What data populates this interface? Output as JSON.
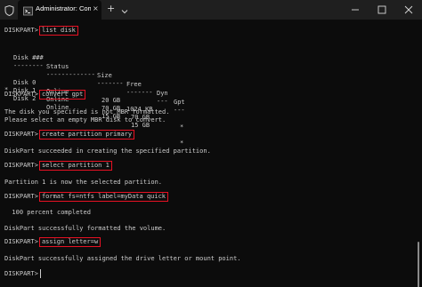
{
  "window": {
    "tab_title": "Administrator: Command Prompt",
    "new_tab_symbol": "+",
    "close_symbol": "×"
  },
  "console": {
    "prompt": "DISKPART>",
    "commands": {
      "list_disk": "list disk",
      "convert_gpt": "convert gpt",
      "create_partition": "create partition primary",
      "select_partition": "select partition 1",
      "format": "format fs=ntfs label=myData quick",
      "assign": "assign letter=w"
    },
    "disk_table": {
      "headers": [
        "Disk ###",
        "Status",
        "Size",
        "Free",
        "Dyn",
        "Gpt"
      ],
      "separators": [
        "--------",
        "-------------",
        "-------",
        "-------",
        "---",
        "---"
      ],
      "rows": [
        {
          "marker": "",
          "disk": "Disk 0",
          "status": "Online",
          "size": "20 GB",
          "free": "1024 KB",
          "dyn": "",
          "gpt": "*"
        },
        {
          "marker": "",
          "disk": "Disk 1",
          "status": "Online",
          "size": "70 GB",
          "free": "70 GB",
          "dyn": "",
          "gpt": ""
        },
        {
          "marker": "*",
          "disk": "Disk 2",
          "status": "Online",
          "size": "15 GB",
          "free": "15 GB",
          "dyn": "",
          "gpt": "*"
        }
      ]
    },
    "messages": {
      "not_mbr_1": "The disk you specified is not MBR formatted.",
      "not_mbr_2": "Please select an empty MBR disk to convert.",
      "created": "DiskPart succeeded in creating the specified partition.",
      "selected": "Partition 1 is now the selected partition.",
      "progress": "  100 percent completed",
      "formatted": "DiskPart successfully formatted the volume.",
      "assigned": "DiskPart successfully assigned the drive letter or mount point."
    }
  },
  "colors": {
    "background": "#0c0c0c",
    "titlebar": "#1f1f1f",
    "text": "#cccccc",
    "highlight": "#e81123"
  },
  "icons": [
    "shield-icon",
    "terminal-tab-icon",
    "close-tab-icon",
    "new-tab-icon",
    "tab-dropdown-icon",
    "minimize-icon",
    "maximize-icon",
    "close-window-icon"
  ]
}
